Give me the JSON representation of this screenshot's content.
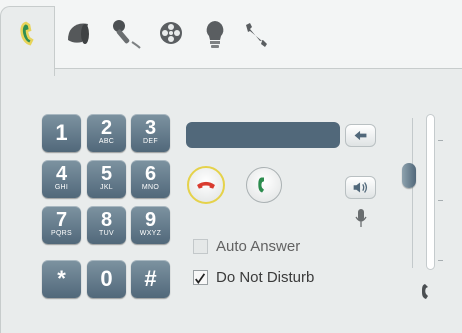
{
  "tabs": [
    {
      "icon": "phone-handset-icon",
      "active": true
    },
    {
      "icon": "speaker-icon",
      "active": false
    },
    {
      "icon": "microphone-icon",
      "active": false
    },
    {
      "icon": "film-reel-icon",
      "active": false
    },
    {
      "icon": "lightbulb-icon",
      "active": false
    },
    {
      "icon": "wrench-icon",
      "active": false
    }
  ],
  "keypad": [
    {
      "digit": "1",
      "letters": ""
    },
    {
      "digit": "2",
      "letters": "ABC"
    },
    {
      "digit": "3",
      "letters": "DEF"
    },
    {
      "digit": "4",
      "letters": "GHI"
    },
    {
      "digit": "5",
      "letters": "JKL"
    },
    {
      "digit": "6",
      "letters": "MNO"
    },
    {
      "digit": "7",
      "letters": "PQRS"
    },
    {
      "digit": "8",
      "letters": "TUV"
    },
    {
      "digit": "9",
      "letters": "WXYZ"
    },
    {
      "digit": "*",
      "letters": ""
    },
    {
      "digit": "0",
      "letters": ""
    },
    {
      "digit": "#",
      "letters": ""
    }
  ],
  "options": {
    "auto_answer_label": "Auto Answer",
    "auto_answer_checked": false,
    "auto_answer_enabled": false,
    "do_not_disturb_label": "Do Not Disturb",
    "do_not_disturb_checked": true
  },
  "number_display": "",
  "volume_level": 0.62,
  "colors": {
    "key": "#5f7687",
    "hangup": "#d93b2f",
    "call": "#2c8c4e",
    "active_ring": "#e5d24a"
  }
}
